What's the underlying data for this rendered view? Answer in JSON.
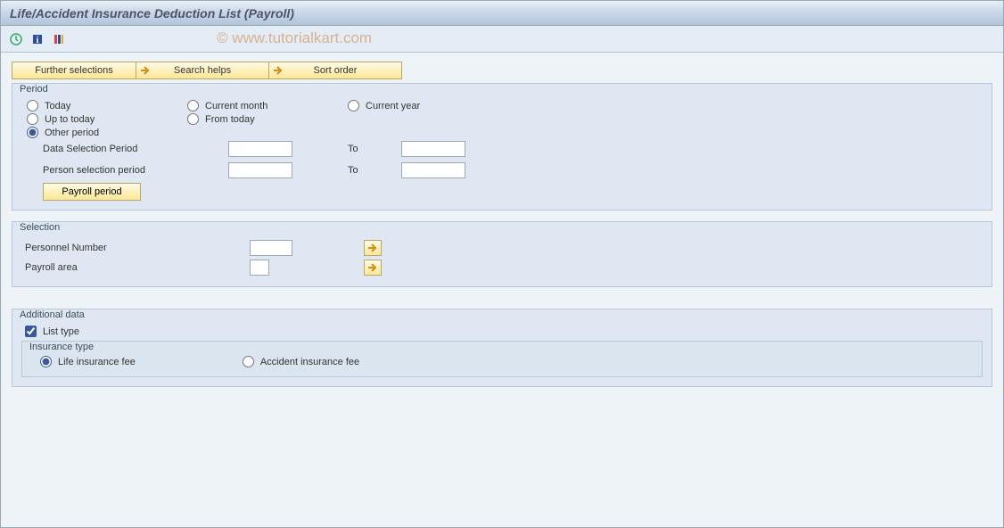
{
  "title": "Life/Accident Insurance Deduction List (Payroll)",
  "watermark": "© www.tutorialkart.com",
  "toolbar": {
    "further_selections": "Further selections",
    "search_helps": "Search helps",
    "sort_order": "Sort order"
  },
  "period": {
    "title": "Period",
    "today": "Today",
    "current_month": "Current month",
    "current_year": "Current year",
    "up_to_today": "Up to today",
    "from_today": "From today",
    "other_period": "Other period",
    "data_selection_period": "Data Selection Period",
    "person_selection_period": "Person selection period",
    "to": "To",
    "payroll_period": "Payroll period",
    "selected": "other_period",
    "data_from": "",
    "data_to": "",
    "person_from": "",
    "person_to": ""
  },
  "selection": {
    "title": "Selection",
    "personnel_number": "Personnel Number",
    "payroll_area": "Payroll area",
    "personnel_number_val": "",
    "payroll_area_val": ""
  },
  "additional": {
    "title": "Additional data",
    "list_type": "List type",
    "list_type_checked": true,
    "insurance_type_title": "Insurance type",
    "life_insurance_fee": "Life insurance fee",
    "accident_insurance_fee": "Accident insurance fee",
    "insurance_selected": "life"
  }
}
